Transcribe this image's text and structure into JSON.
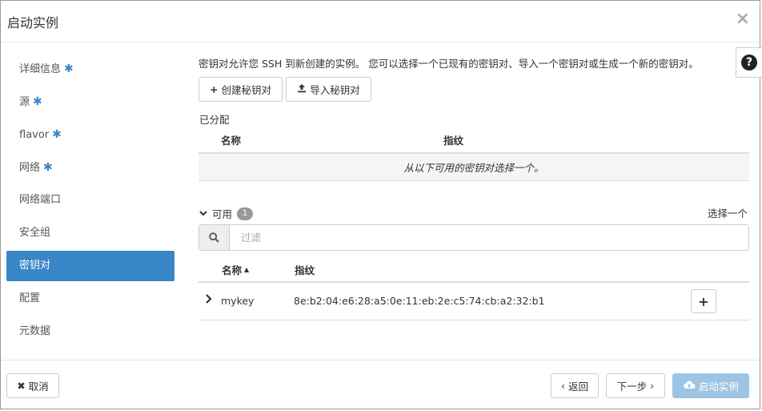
{
  "modal": {
    "title": "启动实例",
    "close": "×"
  },
  "sidebar": {
    "items": [
      {
        "label": "详细信息",
        "required": "✱"
      },
      {
        "label": "源",
        "required": "✱"
      },
      {
        "label": "flavor",
        "required": "✱"
      },
      {
        "label": "网络",
        "required": "✱"
      },
      {
        "label": "网络端口"
      },
      {
        "label": "安全组"
      },
      {
        "label": "密钥对",
        "active": true
      },
      {
        "label": "配置"
      },
      {
        "label": "元数据"
      }
    ]
  },
  "content": {
    "help_text": "密钥对允许您 SSH 到新创建的实例。 您可以选择一个已现有的密钥对、导入一个密钥对或生成一个新的密钥对。",
    "help_icon": "?",
    "create_button": "创建秘钥对",
    "import_button": "导入秘钥对",
    "allocated": {
      "label": "已分配",
      "headers": [
        "名称",
        "指纹"
      ],
      "empty_text": "从以下可用的密钥对选择一个。"
    },
    "available": {
      "label": "可用",
      "count": "1",
      "select_one": "选择一个",
      "filter_placeholder": "过滤",
      "headers": [
        "名称",
        "指纹"
      ],
      "sort_indicator": "▲",
      "rows": [
        {
          "name": "mykey",
          "fingerprint": "8e:b2:04:e6:28:a5:0e:11:eb:2e:c5:74:cb:a2:32:b1",
          "add": "+"
        }
      ]
    }
  },
  "footer": {
    "cancel": "取消",
    "back": "返回",
    "next": "下一步",
    "launch": "启动实例"
  }
}
